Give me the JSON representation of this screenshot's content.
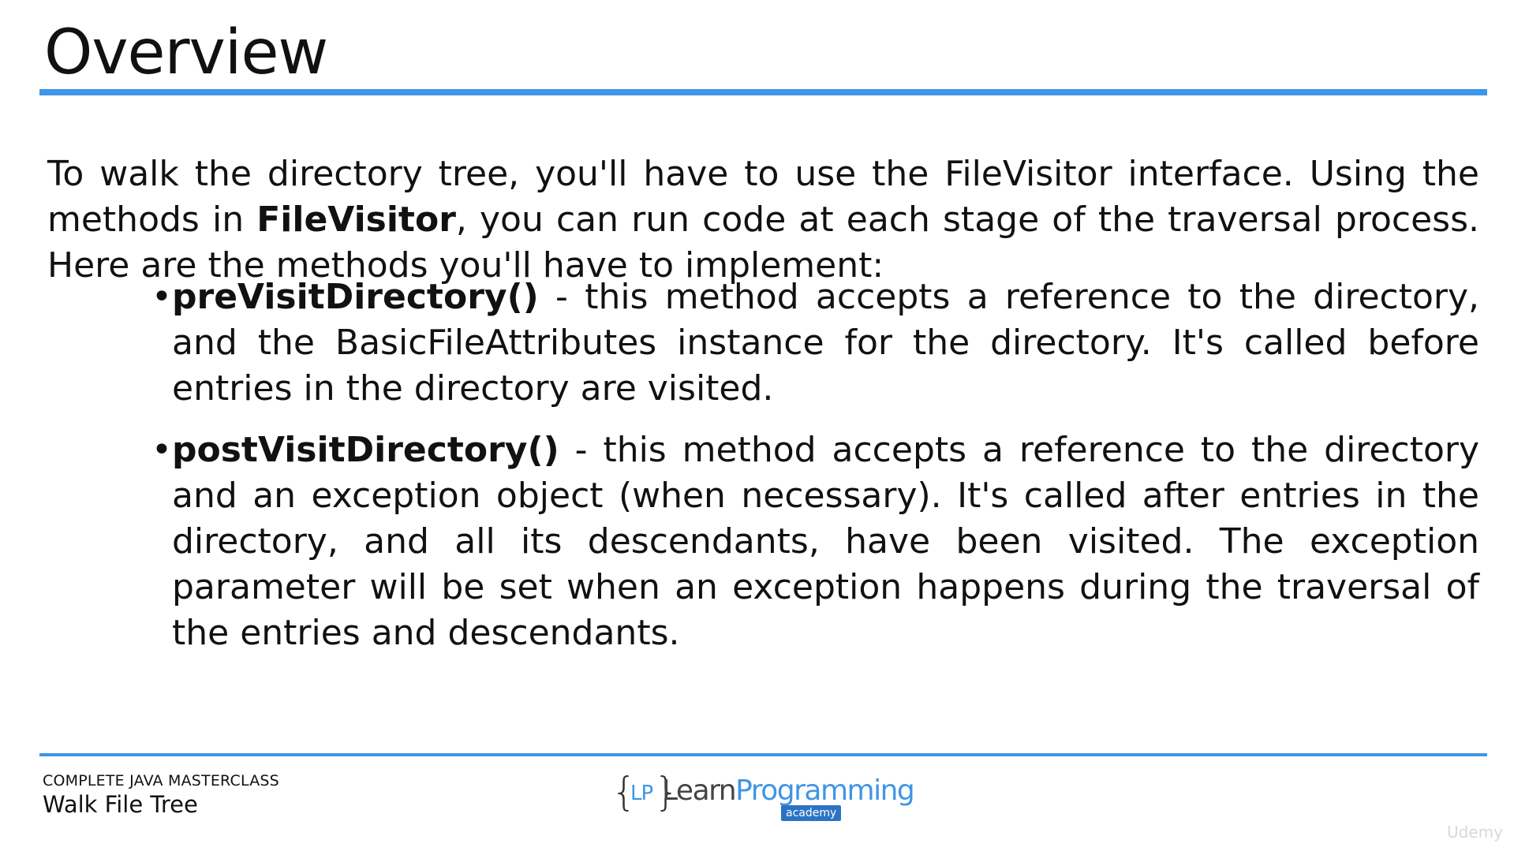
{
  "slide": {
    "title": "Overview",
    "intro_parts": [
      "To walk the directory tree, you'll have to use the FileVisitor interface. Using the methods in ",
      "FileVisitor",
      ", you can run code at each stage of the traversal process. Here are the methods you'll have to implement:"
    ],
    "bullets": [
      {
        "term": "preVisitDirectory()",
        "text": " - this method accepts a reference to the directory, and the BasicFileAttributes instance for the directory. It's called before entries in the directory are visited."
      },
      {
        "term": "postVisitDirectory()",
        "text": " - this method accepts a reference to the directory and an exception object (when necessary). It's called after entries in the directory, and all its descendants, have been visited. The exception parameter will be set when an exception happens during the traversal of the entries and descendants."
      }
    ],
    "bullet_glyph": "•"
  },
  "footer": {
    "course": "COMPLETE JAVA MASTERCLASS",
    "lecture": "Walk File Tree",
    "logo": {
      "brace_open": "{",
      "initials": "LP",
      "brace_close": "}",
      "name_part1": "Learn",
      "name_part2": "Programming",
      "tag": "academy"
    },
    "watermark": "Udemy"
  },
  "colors": {
    "accent": "#3f95e6",
    "text": "#111111"
  }
}
